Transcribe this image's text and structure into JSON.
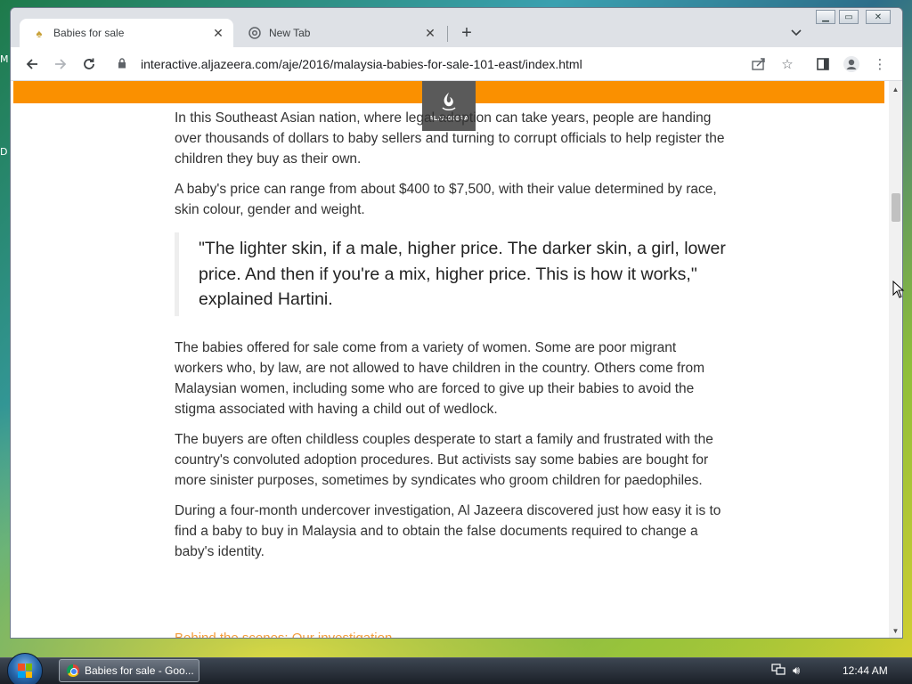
{
  "desktop": {
    "side_letters": [
      "M",
      "D"
    ]
  },
  "browser": {
    "tabs": [
      {
        "title": "Babies for sale",
        "icon": "aljazeera-favicon",
        "active": true
      },
      {
        "title": "New Tab",
        "icon": "chrome-icon",
        "active": false
      }
    ],
    "new_tab_symbol": "+",
    "tab_search_symbol": "⌄",
    "window_controls": [
      "minimize",
      "maximize",
      "close"
    ],
    "url": "interactive.aljazeera.com/aje/2016/malaysia-babies-for-sale-101-east/index.html"
  },
  "page": {
    "brand_color": "#fa9000",
    "logo_text": "ALJAZEERA",
    "paragraphs_before_quote": [
      "In this Southeast Asian nation, where legal adoption can take years, people are handing over thousands of dollars to baby sellers and turning to corrupt officials to help register the children they buy as their own.",
      "A baby's price can range from about $400 to $7,500, with their value determined by race, skin colour, gender and weight."
    ],
    "quote": "\"The lighter skin, if a male, higher price. The darker skin, a girl, lower price. And then if you're a mix, higher price. This is how it works,\" explained Hartini.",
    "paragraphs_after_quote": [
      "The babies offered for sale come from a variety of women. Some are poor migrant workers who, by law, are not allowed to have children in the country. Others come from Malaysian women, including some who are forced to give up their babies to avoid the stigma associated with having a child out of wedlock.",
      "The buyers are often childless couples desperate to start a family and frustrated with the country's convoluted adoption procedures. But activists say some babies are bought for more sinister purposes, sometimes by syndicates who groom children for paedophiles.",
      "During a four-month undercover investigation, Al Jazeera discovered just how easy it is to find a baby to buy in Malaysia and to obtain the false documents required to change a baby's identity."
    ],
    "partial_link_text": "Behind the scenes: Our investigation"
  },
  "taskbar": {
    "task_button_label": "Babies for sale - Goo...",
    "clock": "12:44 AM"
  }
}
